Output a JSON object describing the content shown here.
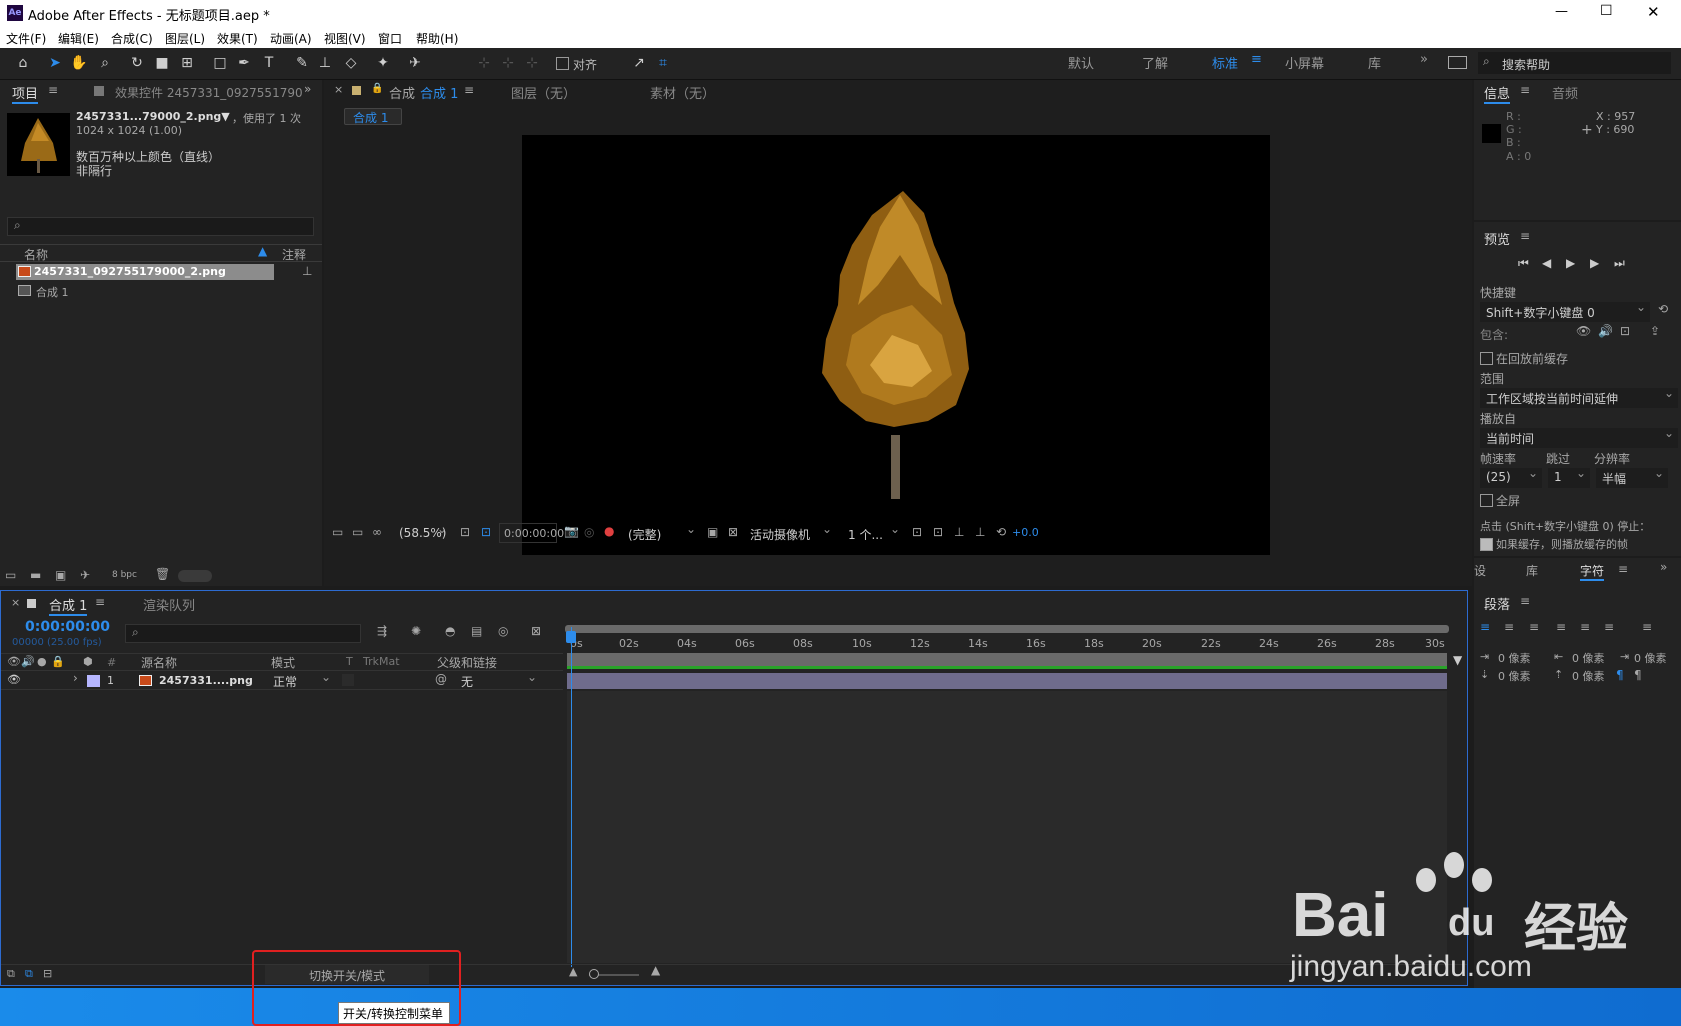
{
  "window": {
    "app_icon": "Ae",
    "title": "Adobe After Effects - 无标题项目.aep *",
    "min_icon": "—",
    "max_icon": "☐",
    "close_icon": "✕"
  },
  "menu": [
    "文件(F)",
    "编辑(E)",
    "合成(C)",
    "图层(L)",
    "效果(T)",
    "动画(A)",
    "视图(V)",
    "窗口",
    "帮助(H)"
  ],
  "toolbar": {
    "align_label": "对齐",
    "workspaces": [
      "默认",
      "了解",
      "标准",
      "小屏幕",
      "库"
    ],
    "active_workspace": "标准",
    "search_placeholder": "搜索帮助"
  },
  "project_panel": {
    "tab_project": "项目",
    "tab_effects": "效果控件 2457331_0927551790",
    "asset_name": "2457331...79000_2.png▼",
    "used_count": "，使用了 1 次",
    "asset_dims": "1024 x 1024 (1.00)",
    "asset_colors": "数百万种以上颜色（直线）",
    "asset_interlace": "非隔行",
    "col_name": "名称",
    "col_comment": "注释",
    "items": [
      "2457331_092755179000_2.png",
      "合成 1"
    ],
    "bpc": "8 bpc"
  },
  "comp_panel": {
    "tab_comp": "合成",
    "tab_comp_name": "合成 1",
    "tab_layer": "图层（无）",
    "tab_footage": "素材（无）",
    "comp_chip": "合成 1",
    "zoom": "(58.5%)",
    "timecode": "0:00:00:00",
    "quality": "(完整)",
    "camera": "活动摄像机",
    "views": "1 个...",
    "exposure": "+0.0"
  },
  "info_panel": {
    "tab_info": "信息",
    "tab_audio": "音频",
    "r": "R :",
    "g": "G :",
    "b": "B :",
    "a": "A : 0",
    "x": "X : 957",
    "y": "Y : 690"
  },
  "preview_panel": {
    "title": "预览",
    "shortcut_label": "快捷键",
    "shortcut_value": "Shift+数字小键盘 0",
    "include_label": "包含:",
    "cache_before": "在回放前缓存",
    "range_label": "范围",
    "range_value": "工作区域按当前时间延伸",
    "play_from_label": "播放自",
    "play_from_value": "当前时间",
    "fps_label": "帧速率",
    "skip_label": "跳过",
    "res_label": "分辨率",
    "fps_value": "(25)",
    "skip_value": "1",
    "res_value": "半幅",
    "fullscreen": "全屏",
    "stop_hint": "点击 (Shift+数字小键盘 0) 停止：",
    "cache_hint": "如果缓存，则播放缓存的帧"
  },
  "char_panel": {
    "tab_set": "设",
    "tab_lib": "库",
    "tab_char": "字符",
    "para_title": "段落",
    "px": "0 像素"
  },
  "timeline": {
    "tab_comp": "合成 1",
    "tab_render": "渲染队列",
    "timecode": "0:00:00:00",
    "frames": "00000 (25.00 fps)",
    "col_hash": "#",
    "col_source": "源名称",
    "col_mode": "模式",
    "col_t": "T",
    "col_trkmat": "TrkMat",
    "col_parent": "父级和链接",
    "layer_num": "1",
    "layer_name": "2457331....png",
    "layer_mode": "正常",
    "layer_parent": "无",
    "ticks": [
      "0s",
      "02s",
      "04s",
      "06s",
      "08s",
      "10s",
      "12s",
      "14s",
      "16s",
      "18s",
      "20s",
      "22s",
      "24s",
      "26s",
      "28s",
      "30s"
    ],
    "toggle_label": "切换开关/模式",
    "tooltip": "开关/转换控制菜单"
  },
  "watermark": {
    "brand": "Bai",
    "brand2": "du",
    "cn": "经验",
    "url": "jingyan.baidu.com"
  },
  "colors": {
    "accent": "#2d8ceb",
    "highlight_box": "#e02020",
    "taskbar": "#1e88e5"
  }
}
